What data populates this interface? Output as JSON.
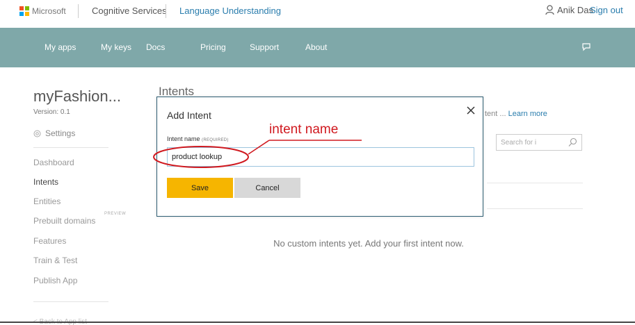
{
  "header": {
    "brand": "Microsoft",
    "service": "Cognitive Services",
    "product": "Language Understanding",
    "user_name": "Anik Das",
    "signout_label": "Sign out"
  },
  "nav": {
    "items": [
      "My apps",
      "My keys",
      "Docs",
      "Pricing",
      "Support",
      "About"
    ]
  },
  "sidebar": {
    "app_name": "myFashion...",
    "version": "Version: 0.1",
    "settings_label": "Settings",
    "items": [
      "Dashboard",
      "Intents",
      "Entities",
      "Prebuilt domains",
      "Features",
      "Train & Test",
      "Publish App"
    ],
    "active_item": "Intents",
    "preview_badge": "PREVIEW",
    "back_link": "< Back to App list"
  },
  "main": {
    "title": "Intents",
    "intro_fragment": "tent ...",
    "learn_more": "Learn more",
    "search_placeholder": "Search for i",
    "empty_message": "No custom intents yet. Add your first intent now."
  },
  "dialog": {
    "title": "Add Intent",
    "field_label": "Intent name",
    "field_required": "(REQUIRED)",
    "field_value": "product lookup",
    "save_label": "Save",
    "cancel_label": "Cancel"
  },
  "annotation": {
    "text": "intent name",
    "color": "#d0191f"
  },
  "colors": {
    "nav_bg": "#7fa8a9",
    "save_button": "#f6b500",
    "link": "#2a7dad",
    "ms_logo": [
      "#f25022",
      "#7fba00",
      "#00a4ef",
      "#ffb900"
    ]
  }
}
